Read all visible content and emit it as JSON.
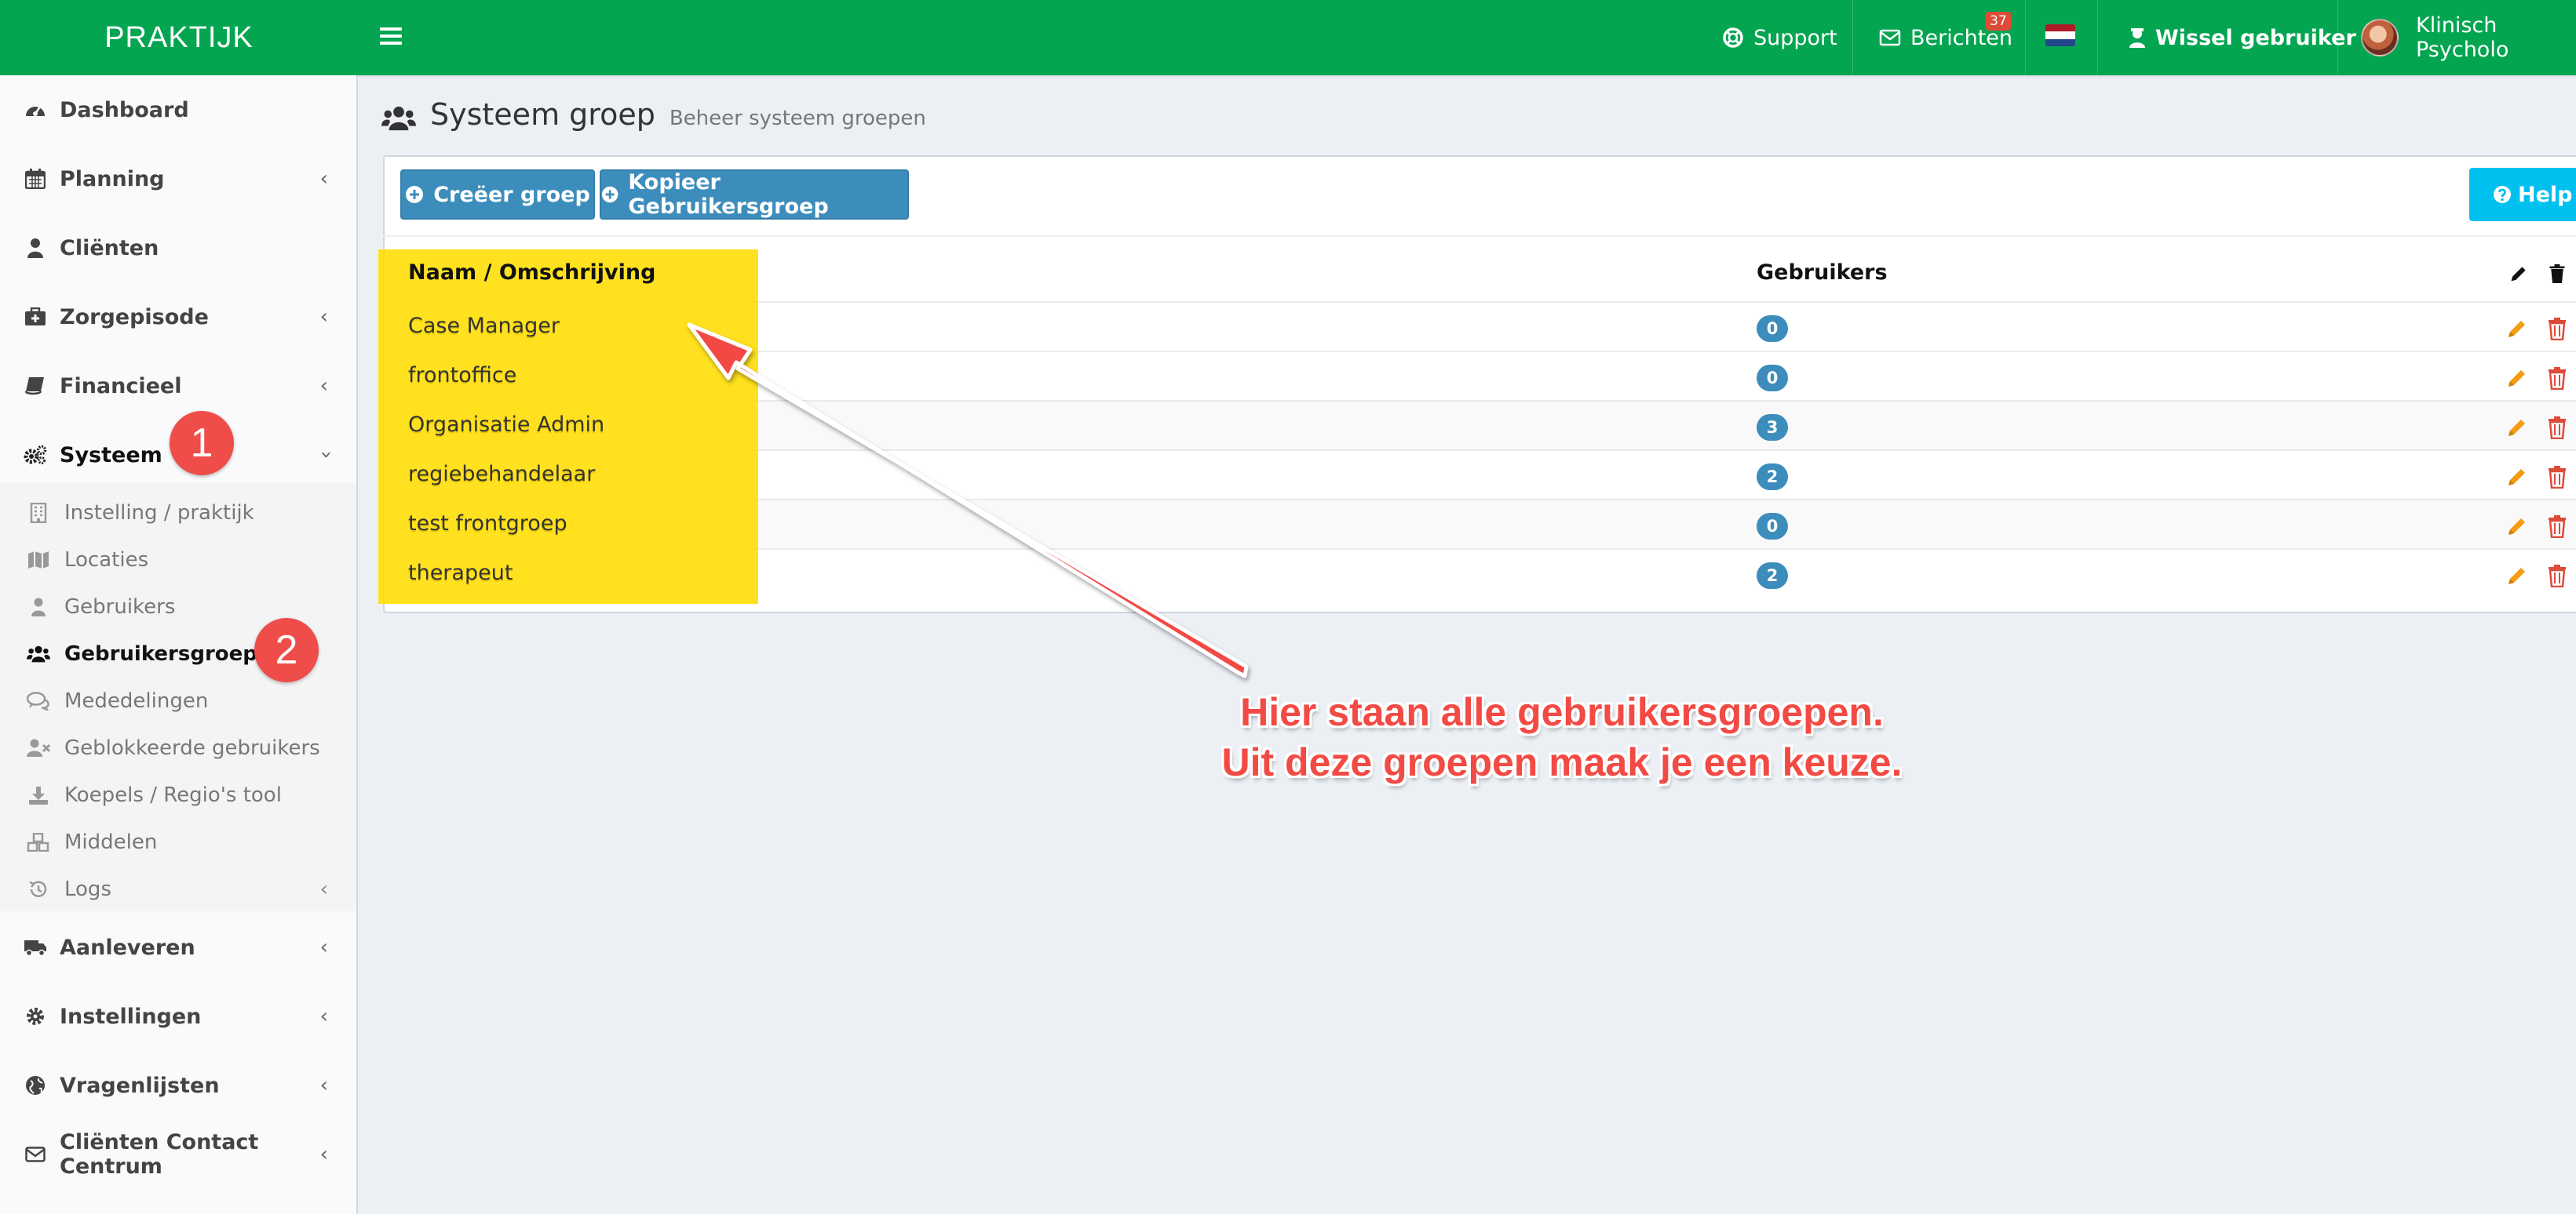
{
  "app": {
    "brand": "PRAKTIJK"
  },
  "topbar": {
    "support": "Support",
    "messages": "Berichten",
    "messages_badge": "37",
    "switch_user": "Wissel gebruiker",
    "user_name": "Klinisch Psycholo"
  },
  "sidebar": {
    "items": [
      {
        "label": "Dashboard",
        "icon": "dashboard-icon"
      },
      {
        "label": "Planning",
        "icon": "calendar-icon"
      },
      {
        "label": "Cliënten",
        "icon": "user-icon"
      },
      {
        "label": "Zorgepisode",
        "icon": "medkit-icon"
      },
      {
        "label": "Financieel",
        "icon": "book-icon"
      },
      {
        "label": "Systeem",
        "icon": "cogs-icon"
      }
    ],
    "systeem_sub": [
      {
        "label": "Instelling / praktijk",
        "icon": "building-icon"
      },
      {
        "label": "Locaties",
        "icon": "map-icon"
      },
      {
        "label": "Gebruikers",
        "icon": "user-icon"
      },
      {
        "label": "Gebruikersgroepen",
        "icon": "users-icon"
      },
      {
        "label": "Mededelingen",
        "icon": "comments-icon"
      },
      {
        "label": "Geblokkeerde gebruikers",
        "icon": "user-times-icon"
      },
      {
        "label": "Koepels / Regio's tool",
        "icon": "download-icon"
      },
      {
        "label": "Middelen",
        "icon": "cubes-icon"
      },
      {
        "label": "Logs",
        "icon": "history-icon"
      }
    ],
    "bottom_items": [
      {
        "label": "Aanleveren",
        "icon": "truck-icon"
      },
      {
        "label": "Instellingen",
        "icon": "cog-icon"
      },
      {
        "label": "Vragenlijsten",
        "icon": "globe-icon"
      },
      {
        "label": "Cliënten Contact Centrum",
        "icon": "envelope-icon"
      }
    ]
  },
  "page": {
    "title": "Systeem groep",
    "subtitle": "Beheer systeem groepen",
    "create_button": "Creëer groep",
    "copy_button": "Kopieer Gebruikersgroep",
    "help_button": "Help"
  },
  "table": {
    "headers": {
      "name": "Naam / Omschrijving",
      "users": "Gebruikers"
    },
    "rows": [
      {
        "name": "Case Manager",
        "users": "0"
      },
      {
        "name": "frontoffice",
        "users": "0"
      },
      {
        "name": "Organisatie Admin",
        "users": "3"
      },
      {
        "name": "regiebehandelaar",
        "users": "2"
      },
      {
        "name": "test frontgroep",
        "users": "0"
      },
      {
        "name": "therapeut",
        "users": "2"
      }
    ]
  },
  "annotations": {
    "step1": "1",
    "step2": "2",
    "callout_line1": "Hier staan alle gebruikersgroepen.",
    "callout_line2": "Uit deze groepen maak je een keuze."
  },
  "colors": {
    "topbar": "#04a551",
    "primary": "#3c8dbc",
    "help": "#00c0ef",
    "highlight": "#ffdd00",
    "annotation": "#ef4d4a",
    "edit": "#f39c12",
    "delete": "#dd4b39"
  }
}
